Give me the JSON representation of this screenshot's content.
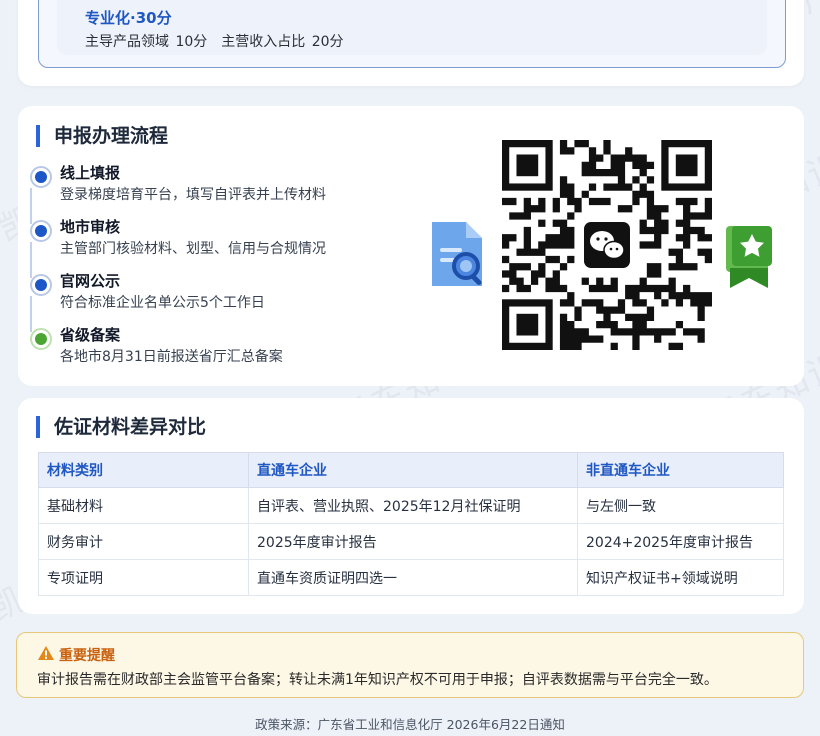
{
  "watermark": "凯东知识产权",
  "specialization": {
    "title": "专业化·30分",
    "desc": "主导产品领域 10分　主营收入占比 20分"
  },
  "process": {
    "title": "申报办理流程",
    "steps": [
      {
        "title": "线上填报",
        "desc": "登录梯度培育平台，填写自评表并上传材料",
        "color": "blue"
      },
      {
        "title": "地市审核",
        "desc": "主管部门核验材料、划型、信用与合规情况",
        "color": "blue"
      },
      {
        "title": "官网公示",
        "desc": "符合标准企业名单公示5个工作日",
        "color": "blue"
      },
      {
        "title": "省级备案",
        "desc": "各地市8月31日前报送省厅汇总备案",
        "color": "green"
      }
    ],
    "icons": [
      "document-search-icon",
      "wechat-icon",
      "bookmark-star-icon"
    ]
  },
  "comparison": {
    "title": "佐证材料差异对比",
    "headers": [
      "材料类别",
      "直通车企业",
      "非直通车企业"
    ],
    "rows": [
      [
        "基础材料",
        "自评表、营业执照、2025年12月社保证明",
        "与左侧一致"
      ],
      [
        "财务审计",
        "2025年度审计报告",
        "2024+2025年度审计报告"
      ],
      [
        "专项证明",
        "直通车资质证明四选一",
        "知识产权证书+领域说明"
      ]
    ]
  },
  "alert": {
    "title": "重要提醒",
    "text": "审计报告需在财政部主会监管平台备案；转让未满1年知识产权不可用于申报；自评表数据需与平台完全一致。"
  },
  "footer": "政策来源：广东省工业和信息化厅 2026年6月22日通知",
  "colors": {
    "accent": "#2b63d9",
    "green": "#4ba532",
    "warning": "#c9620f"
  }
}
